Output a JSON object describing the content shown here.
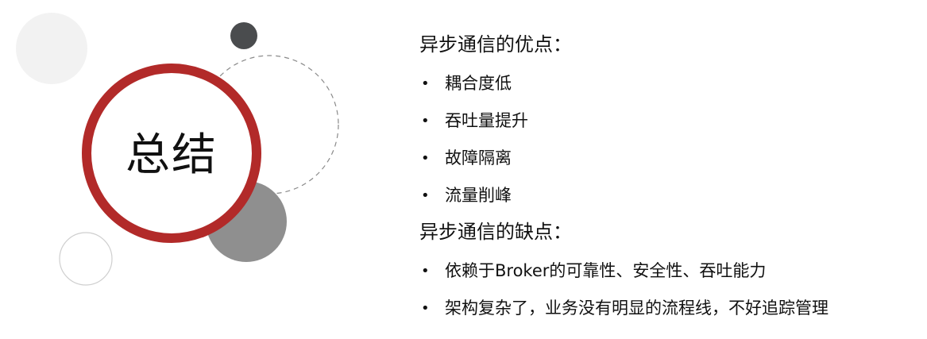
{
  "summary": {
    "title": "总结",
    "colors": {
      "ring": "#B22A29",
      "dark_dot": "#4A4C4E",
      "gray_circle": "#8F8F8F",
      "light_circle": "#F2F2F2",
      "outline_circle": "#CFCFCF",
      "dashed_circle": "#8A8A8A"
    }
  },
  "advantages": {
    "heading": "异步通信的优点：",
    "items": [
      {
        "bullet": "•",
        "text": "耦合度低"
      },
      {
        "bullet": "•",
        "text": "吞吐量提升"
      },
      {
        "bullet": "•",
        "text": "故障隔离"
      },
      {
        "bullet": "•",
        "text": "流量削峰"
      }
    ]
  },
  "disadvantages": {
    "heading": "异步通信的缺点：",
    "items": [
      {
        "bullet": "•",
        "text": "依赖于Broker的可靠性、安全性、吞吐能力"
      },
      {
        "bullet": "•",
        "text": "架构复杂了，业务没有明显的流程线，不好追踪管理"
      }
    ]
  }
}
